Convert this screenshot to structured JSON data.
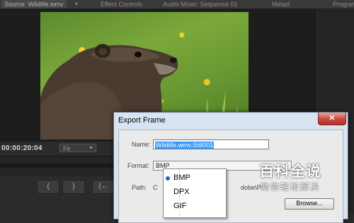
{
  "tabs": {
    "source": "Source: Wildlife.wmv",
    "effect_controls": "Effect Controls",
    "audio_mixer": "Audio Mixer: Sequence 01",
    "metadata": "Metad",
    "program": "Program"
  },
  "monitor": {
    "timecode": "00:00:20:04",
    "fit_value": "Fit",
    "controls": [
      "{",
      "}",
      "{←"
    ]
  },
  "dialog": {
    "title": "Export Frame",
    "close_label": "✕",
    "name_label": "Name:",
    "name_value": "Wildlife.wmv.Still001",
    "format_label": "Format:",
    "format_value": "BMP",
    "path_label": "Path:",
    "path_prefix": "C",
    "path_suffix": "dobe\\Pr",
    "browse_label": "Browse..."
  },
  "format_menu": {
    "items": [
      "BMP",
      "DPX",
      "GIF"
    ],
    "selected": "BMP"
  },
  "watermark": {
    "title": "百科全说",
    "subtitle": "助你轻松解决"
  },
  "colors": {
    "accent": "#1e64c8",
    "selection": "#3399ff",
    "close_red": "#c9483a"
  }
}
